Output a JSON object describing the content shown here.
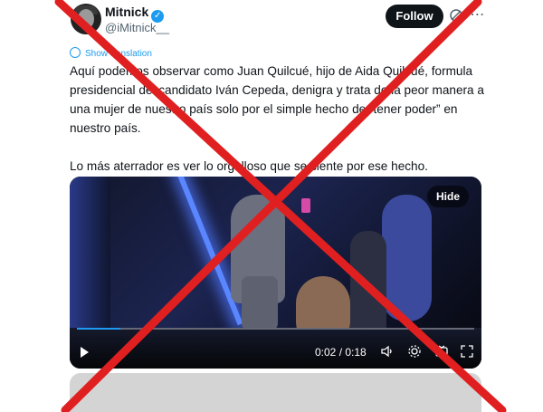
{
  "author": {
    "name": "Mitnick",
    "handle": "@iMitnick__",
    "verified_glyph": "✓",
    "follow_label": "Follow",
    "more_glyph": "⋯"
  },
  "translate_label": "Show translation",
  "tweet": {
    "paragraph_1": "Aquí podemos observar como Juan Quilcué, hijo de Aida Quilcué, formula presidencial del candidato Iván Cepeda, denigra y trata de la peor manera a una mujer de nuestro país solo por el simple hecho de “tener poder” en nuestro país.",
    "paragraph_2": "Lo más aterrador es ver lo orgulloso que se siente por ese hecho."
  },
  "video": {
    "hide_label": "Hide",
    "time_label": "0:02 / 0:18",
    "progress": 0.11
  },
  "icons": {
    "grok": "grok-icon",
    "more": "more-icon",
    "play": "play-icon",
    "volume": "volume-icon",
    "settings": "settings-icon",
    "caption": "caption-icon",
    "fullscreen": "fullscreen-icon"
  },
  "colors": {
    "accent": "#1d9bf0",
    "x_mark": "#e02020",
    "follow_bg": "#0f1419"
  }
}
